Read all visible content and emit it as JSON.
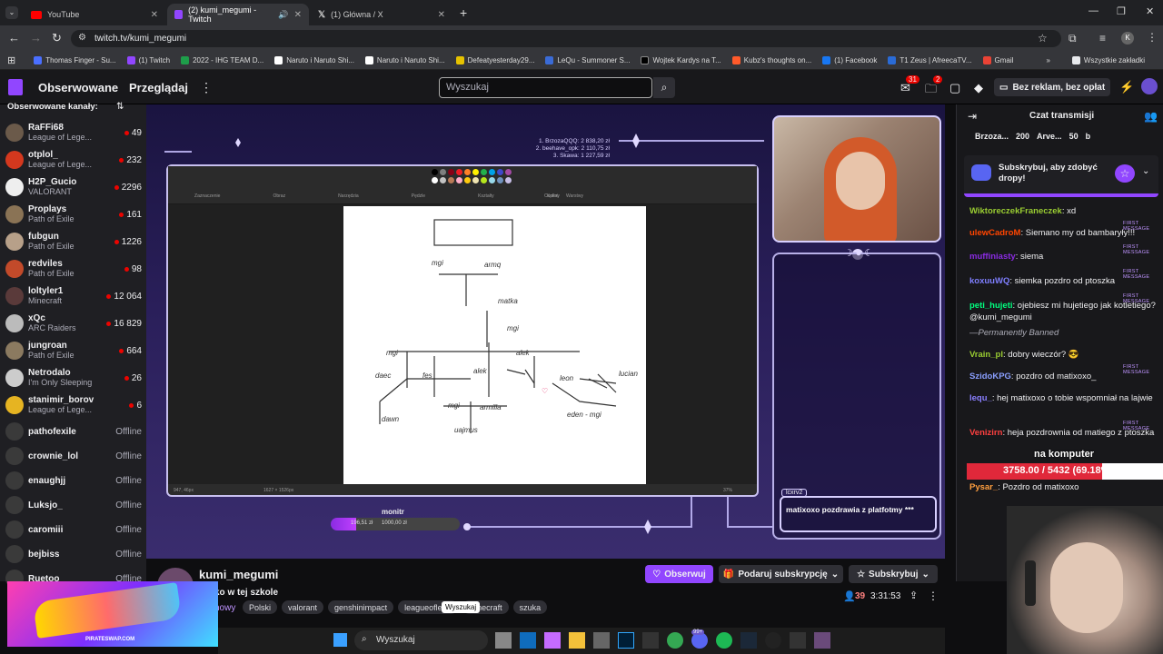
{
  "browser": {
    "tabs": [
      {
        "title": "YouTube",
        "icon": "youtube-icon",
        "active": false
      },
      {
        "title": "(2) kumi_megumi - Twitch",
        "icon": "twitch-icon",
        "active": true
      },
      {
        "title": "(1) Główna / X",
        "icon": "x-icon",
        "active": false
      }
    ],
    "url": "twitch.tv/kumi_megumi",
    "bookmarks": [
      "Thomas Finger - Su...",
      "(1) Twitch",
      "2022 - IHG TEAM D...",
      "Naruto i Naruto Shi...",
      "Naruto i Naruto Shi...",
      "Defeatyesterday29...",
      "LeQu - Summoner S...",
      "Wojtek Kardys na T...",
      "Kubz's thoughts on...",
      "(1) Facebook",
      "T1 Zeus | AfreecaTV...",
      "Gmail"
    ],
    "all_bookmarks": "Wszystkie zakładki",
    "profile_letter": "K"
  },
  "nav": {
    "following": "Obserwowane",
    "browse": "Przeglądaj",
    "search_placeholder": "Wyszukaj",
    "notif_count": "31",
    "inbox_count": "2",
    "ad_free": "Bez reklam, bez opłat"
  },
  "sidebar": {
    "header": "Obserwowane kanały:",
    "channels": [
      {
        "name": "RaFFi68",
        "game": "League of Lege...",
        "viewers": "49",
        "color": "#6b5a4a"
      },
      {
        "name": "otplol_",
        "game": "League of Lege...",
        "viewers": "232",
        "color": "#d4381e"
      },
      {
        "name": "H2P_Gucio",
        "game": "VALORANT",
        "viewers": "2296",
        "color": "#eeeeee"
      },
      {
        "name": "Proplays",
        "game": "Path of Exile",
        "viewers": "161",
        "color": "#8a7355"
      },
      {
        "name": "fubgun",
        "game": "Path of Exile",
        "viewers": "1226",
        "color": "#b7a089"
      },
      {
        "name": "redviles",
        "game": "Path of Exile",
        "viewers": "98",
        "color": "#c24a2a"
      },
      {
        "name": "loltyler1",
        "game": "Minecraft",
        "viewers": "12 064",
        "color": "#5a3a3a"
      },
      {
        "name": "xQc",
        "game": "ARC Raiders",
        "viewers": "16 829",
        "color": "#bbbbbb"
      },
      {
        "name": "jungroan",
        "game": "Path of Exile",
        "viewers": "664",
        "color": "#8b7a60"
      },
      {
        "name": "Netrodalo",
        "game": "I'm Only Sleeping",
        "viewers": "26",
        "color": "#cccccc"
      },
      {
        "name": "stanimir_borov",
        "game": "League of Lege...",
        "viewers": "6",
        "color": "#e6b422"
      }
    ],
    "offline": [
      {
        "name": "pathofexile",
        "status": "Offline"
      },
      {
        "name": "crownie_lol",
        "status": "Offline"
      },
      {
        "name": "enaughjj",
        "status": "Offline"
      },
      {
        "name": "Luksjo_",
        "status": "Offline"
      },
      {
        "name": "caromiii",
        "status": "Offline"
      },
      {
        "name": "bejbiss",
        "status": "Offline"
      },
      {
        "name": "Ruetoo",
        "status": "Offline"
      }
    ]
  },
  "stream": {
    "leaderboard": [
      "1. BrzozaQQQ: 2 838,20 zł",
      "2. beehave_opk: 2 110,75 zł",
      "3. Skawa: 1 227,59 zł"
    ],
    "goal_label": "monitr",
    "goal_current": "196,51 zł",
    "goal_target": "1000,00 zł",
    "goal_fraction": 0.1965,
    "donor": "lcxrv2",
    "donation_text": "matixoxo pozdrawia z platfotmy ***",
    "paint_labels": [
      "Zaznaczenie",
      "Obraz",
      "Narzędzia",
      "Pędzle",
      "Kształty",
      "Kolory",
      "Copilot",
      "Warstwy"
    ],
    "paint_status_left": "947, 46px",
    "paint_status_mid": "1627 × 1526px",
    "paint_zoom": "37%",
    "tree_nodes": [
      "mgi",
      "armq",
      "matka",
      "mgi",
      "alek",
      "mgi",
      "fes",
      "alek",
      "leon",
      "lucian",
      "daec",
      "mgi",
      "armilla",
      "eden - mgi",
      "dawn",
      "uajmus"
    ]
  },
  "channel": {
    "name": "kumi_megumi",
    "title": "ko w tej szkole",
    "category": "nowy",
    "tags": [
      "Polski",
      "valorant",
      "genshinimpact",
      "leagueoflege",
      "minecraft",
      "szuka"
    ],
    "follow": "Obserwuj",
    "gift": "Podaruj subskrypcję",
    "subscribe": "Subskrybuj",
    "viewers": "39",
    "uptime": "3:31:53",
    "tooltip": "Wyszukaj"
  },
  "chat": {
    "title": "Czat transmisji",
    "leaders": [
      {
        "name": "Brzoza...",
        "value": ""
      },
      {
        "name": "",
        "value": "200"
      },
      {
        "name": "Arve...",
        "value": ""
      },
      {
        "name": "",
        "value": "50"
      },
      {
        "name": "b",
        "value": ""
      }
    ],
    "drops_text": "Subskrybuj, aby zdobyć dropy!",
    "first_message_label": "FIRST MESSAGE",
    "messages": [
      {
        "user": "WiktoreczekFraneczek",
        "color": "#9acd32",
        "text": "xd",
        "first": false
      },
      {
        "user": "ulewCadroM",
        "color": "#ff4500",
        "text": "Siemano my od bambaryły!!!",
        "first": true
      },
      {
        "user": "muffiniasty",
        "color": "#8a2be2",
        "text": "siema",
        "first": true
      },
      {
        "user": "koxuuWQ",
        "color": "#7f7fff",
        "text": "siemka pozdro od ptoszka",
        "first": true
      },
      {
        "user": "peti_hujeti",
        "color": "#00ff7f",
        "text": "ojebiesz mi hujetiego jak kotletiego? @kumi_megumi",
        "first": true
      },
      {
        "user": "",
        "color": "#adadb8",
        "text": "—Permanently Banned",
        "first": false
      },
      {
        "user": "Vrain_pl",
        "color": "#9acd32",
        "text": "dobry wieczór? 😎",
        "first": false
      },
      {
        "user": "SzidoKPG",
        "color": "#8a9fff",
        "text": "pozdro od matixoxo_",
        "first": true
      },
      {
        "user": "lequ_",
        "color": "#8a7fff",
        "text": "hej matixoxo o tobie wspomniał na lajwie",
        "first": false
      },
      {
        "user": "Venizirn",
        "color": "#ff4040",
        "text": "heja pozdrownia od matiego z ptoszka",
        "first": true
      },
      {
        "user": "Pysar_",
        "color": "#ff9f3f",
        "text": "Pozdro od matixoxo",
        "first": false
      },
      {
        "user": "lcxrv2",
        "color": "#8a7fff",
        "text": "matixoxo pozdrawia z platfotmy",
        "first": true
      }
    ],
    "overlay_label": "na komputer",
    "overlay_progress": "3758.00 / 5432 (69.18%)",
    "overlay_fraction": 0.6918
  },
  "taskbar": {
    "search": "Wyszukaj",
    "badge": "99+"
  },
  "ad": {
    "brand": "PIRATESWAP.COM"
  }
}
